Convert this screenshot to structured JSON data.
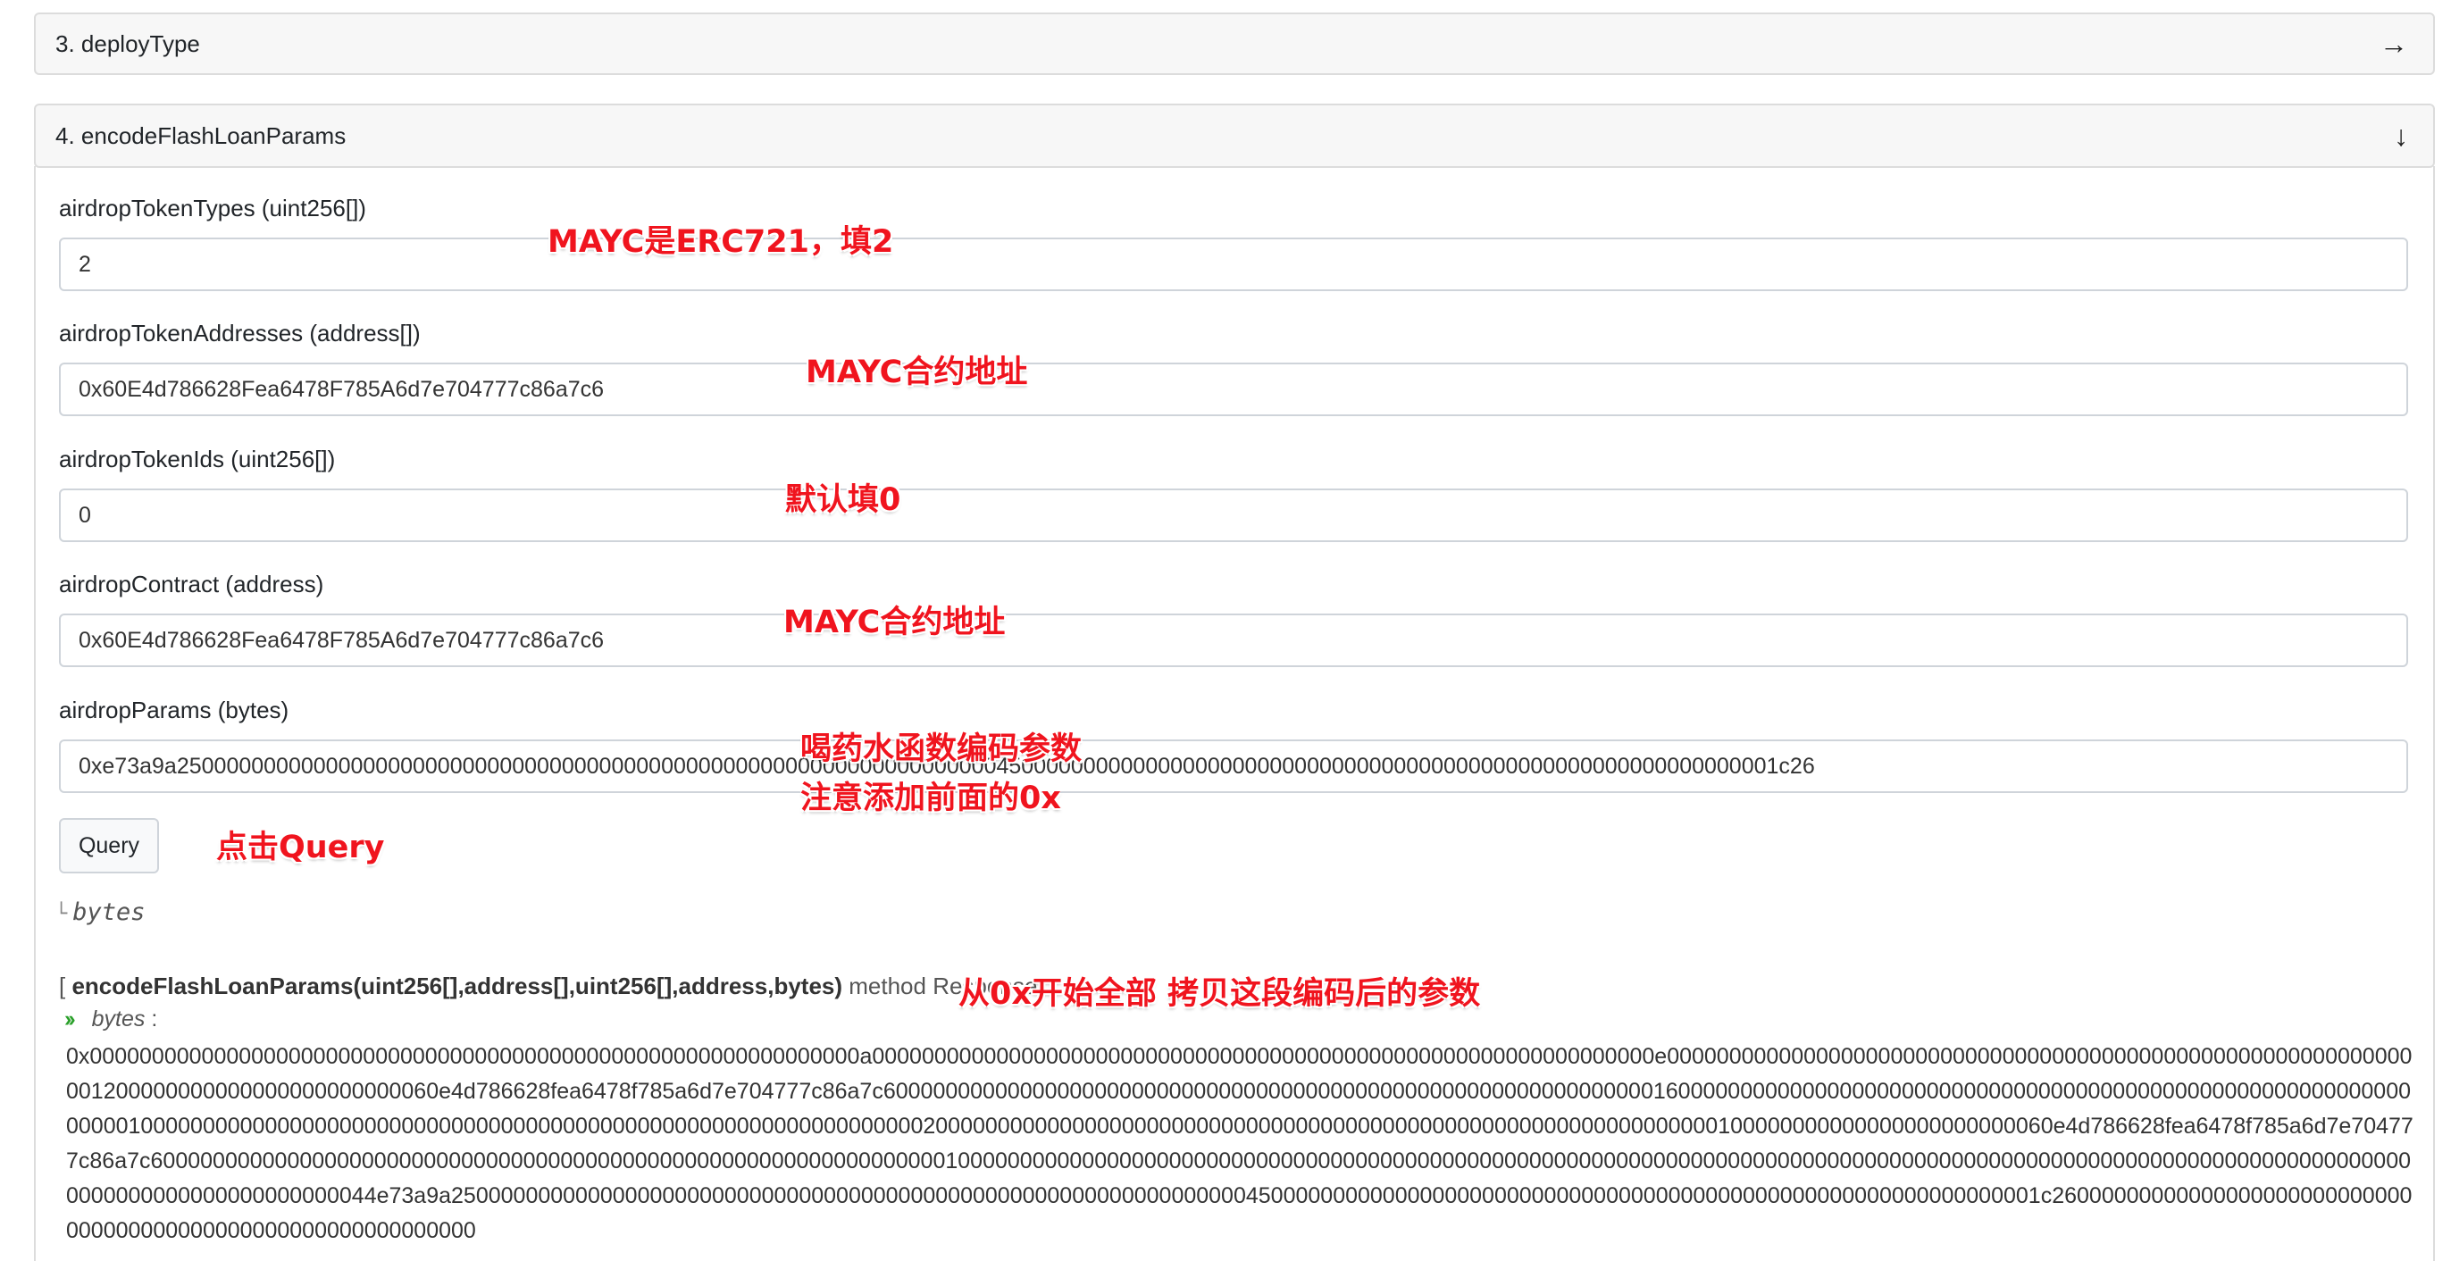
{
  "panels": {
    "deploy_type": {
      "title": "3. deployType",
      "icon": "arrow-right-icon"
    },
    "encode": {
      "title": "4. encodeFlashLoanParams",
      "icon": "arrow-down-icon"
    }
  },
  "fields": {
    "token_types": {
      "label": "airdropTokenTypes (uint256[])",
      "value": "2"
    },
    "token_addresses": {
      "label": "airdropTokenAddresses (address[])",
      "value": "0x60E4d786628Fea6478F785A6d7e704777c86a7c6"
    },
    "token_ids": {
      "label": "airdropTokenIds (uint256[])",
      "value": "0"
    },
    "contract": {
      "label": "airdropContract (address)",
      "value": "0x60E4d786628Fea6478F785A6d7e704777c86a7c6"
    },
    "params": {
      "label": "airdropParams (bytes)",
      "value": "0xe73a9a250000000000000000000000000000000000000000000000000000000000000000450000000000000000000000000000000000000000000000000000000000001c26"
    }
  },
  "query_button": {
    "label": "Query"
  },
  "return_type": "bytes",
  "response": {
    "method": "encodeFlashLoanParams(uint256[],address[],uint256[],address,bytes)",
    "prefix": "[ ",
    "suffix": " method Response",
    "type": "bytes",
    "value": "0x00000000000000000000000000000000000000000000000000000000000000a000000000000000000000000000000000000000000000000000000000000000e000000000000000000000000000000000000000000000000000000000000001200000000000000000000000060e4d786628fea6478f785a6d7e704777c86a7c6000000000000000000000000000000000000000000000000000000000000016000000000000000000000000000000000000000000000000000000000000000010000000000000000000000000000000000000000000000000000000000000002000000000000000000000000000000000000000000000000000000000000000100000000000000000000000060e4d786628fea6478f785a6d7e704777c86a7c600000000000000000000000000000000000000000000000000000000000000010000000000000000000000000000000000000000000000000000000000000000000000000000000000000000000000000000000000000000000000000000000000000000000044e73a9a25000000000000000000000000000000000000000000000000000000000000004500000000000000000000000000000000000000000000000000000000000001c26000000000000000000000000000000000000000000000000000000000000"
  },
  "annotations": {
    "a1": "MAYC是ERC721，填2",
    "a2": "MAYC合约地址",
    "a3": "默认填0",
    "a4": "MAYC合约地址",
    "a5_line1": "喝药水函数编码参数",
    "a5_line2": "注意添加前面的0x",
    "a6": "点击Query",
    "a7": "从0x开始全部 拷贝这段编码后的参数"
  },
  "colors": {
    "annotation": "#f0141e",
    "chevron": "#2aa02a"
  }
}
